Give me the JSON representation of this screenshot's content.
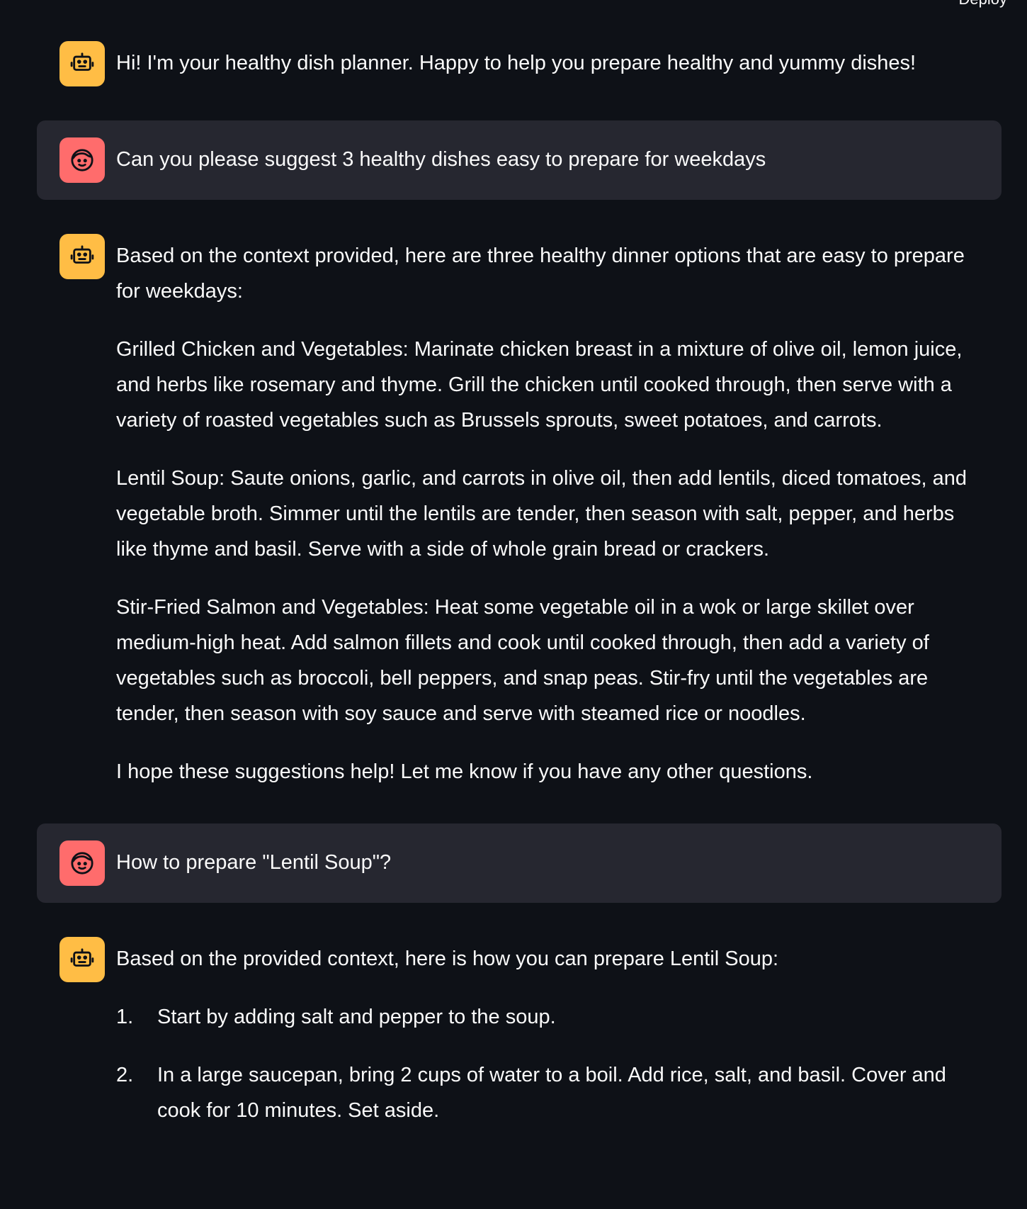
{
  "header": {
    "deploy_label": "Deploy"
  },
  "messages": {
    "m1": {
      "role": "assistant",
      "icon": "robot-icon",
      "text": "Hi! I'm your healthy dish planner. Happy to help you prepare healthy and yummy dishes!"
    },
    "m2": {
      "role": "user",
      "icon": "face-icon",
      "text": "Can you please suggest 3 healthy dishes easy to prepare for weekdays"
    },
    "m3": {
      "role": "assistant",
      "icon": "robot-icon",
      "paragraphs": [
        "Based on the context provided, here are three healthy dinner options that are easy to prepare for weekdays:",
        "Grilled Chicken and Vegetables: Marinate chicken breast in a mixture of olive oil, lemon juice, and herbs like rosemary and thyme. Grill the chicken until cooked through, then serve with a variety of roasted vegetables such as Brussels sprouts, sweet potatoes, and carrots.",
        "Lentil Soup: Saute onions, garlic, and carrots in olive oil, then add lentils, diced tomatoes, and vegetable broth. Simmer until the lentils are tender, then season with salt, pepper, and herbs like thyme and basil. Serve with a side of whole grain bread or crackers.",
        "Stir-Fried Salmon and Vegetables: Heat some vegetable oil in a wok or large skillet over medium-high heat. Add salmon fillets and cook until cooked through, then add a variety of vegetables such as broccoli, bell peppers, and snap peas. Stir-fry until the vegetables are tender, then season with soy sauce and serve with steamed rice or noodles.",
        "I hope these suggestions help! Let me know if you have any other questions."
      ]
    },
    "m4": {
      "role": "user",
      "icon": "face-icon",
      "text": "How to prepare \"Lentil Soup\"?"
    },
    "m5": {
      "role": "assistant",
      "icon": "robot-icon",
      "intro": "Based on the provided context, here is how you can prepare Lentil Soup:",
      "steps": [
        {
          "num": "1.",
          "text": "Start by adding salt and pepper to the soup."
        },
        {
          "num": "2.",
          "text": "In a large saucepan, bring 2 cups of water to a boil. Add rice, salt, and basil. Cover and cook for 10 minutes. Set aside."
        }
      ]
    }
  },
  "colors": {
    "background": "#0e1117",
    "user_bubble": "#262730",
    "bot_avatar": "#ffbd45",
    "user_avatar": "#ff6c6c",
    "text": "#fafafa"
  }
}
